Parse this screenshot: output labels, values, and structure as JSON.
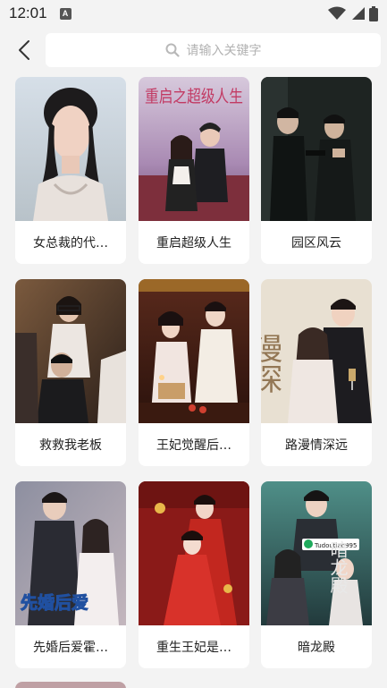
{
  "status": {
    "time": "12:01",
    "notification_letter": "A"
  },
  "search": {
    "placeholder": "请输入关键字"
  },
  "dramas": [
    {
      "title": "女总裁的代…"
    },
    {
      "title": "重启超级人生",
      "poster_text": "重启之超级人生"
    },
    {
      "title": "园区风云"
    },
    {
      "title": "救救我老板"
    },
    {
      "title": "王妃觉醒后…"
    },
    {
      "title": "路漫情深远",
      "poster_text": "漫深"
    },
    {
      "title": "先婚后爱霍…",
      "poster_text": "先婚后爱"
    },
    {
      "title": "重生王妃是…"
    },
    {
      "title": "暗龙殿",
      "poster_text": "暗龙殿",
      "poster_badge": "Tudoutiao995"
    }
  ]
}
